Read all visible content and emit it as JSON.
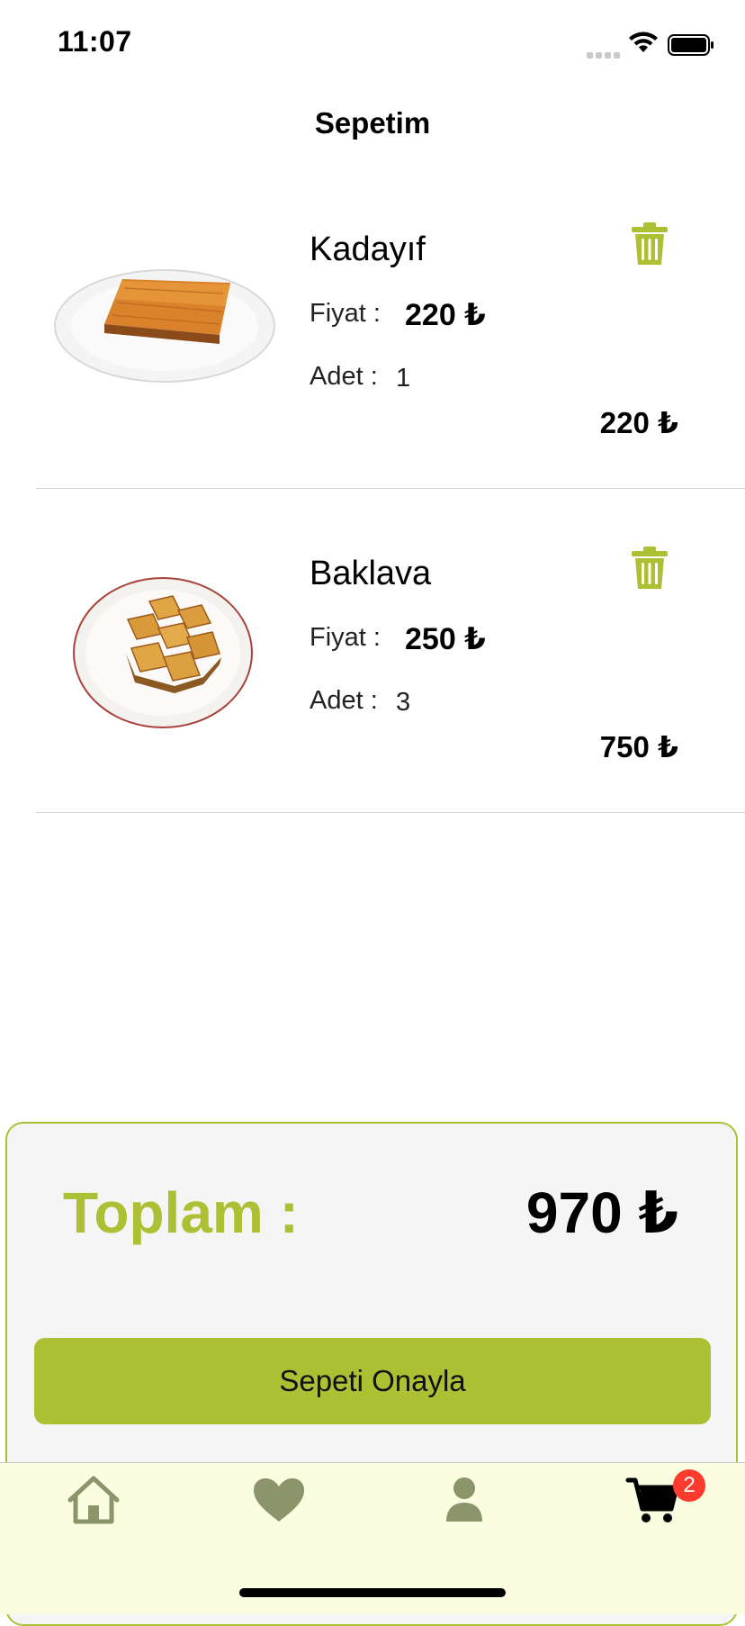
{
  "status_bar": {
    "time": "11:07"
  },
  "nav": {
    "title": "Sepetim"
  },
  "cart": {
    "items": [
      {
        "name": "Kadayıf",
        "price_label": "Fiyat :",
        "price": "220 ₺",
        "qty_label": "Adet :",
        "qty": "1",
        "line_total": "220 ₺",
        "image": "kadayif-plate"
      },
      {
        "name": "Baklava",
        "price_label": "Fiyat :",
        "price": "250 ₺",
        "qty_label": "Adet :",
        "qty": "3",
        "line_total": "750 ₺",
        "image": "baklava-plate"
      }
    ]
  },
  "summary": {
    "total_label": "Toplam :",
    "total_value": "970 ₺",
    "confirm_label": "Sepeti Onayla"
  },
  "tab_bar": {
    "tabs": [
      {
        "icon": "home-icon"
      },
      {
        "icon": "heart-icon"
      },
      {
        "icon": "person-icon"
      },
      {
        "icon": "cart-icon"
      }
    ],
    "cart_badge": "2"
  },
  "colors": {
    "accent": "#adc034",
    "tab_bg": "#fbfde0",
    "tab_icon": "#8c946a",
    "badge": "#ff3b30"
  }
}
